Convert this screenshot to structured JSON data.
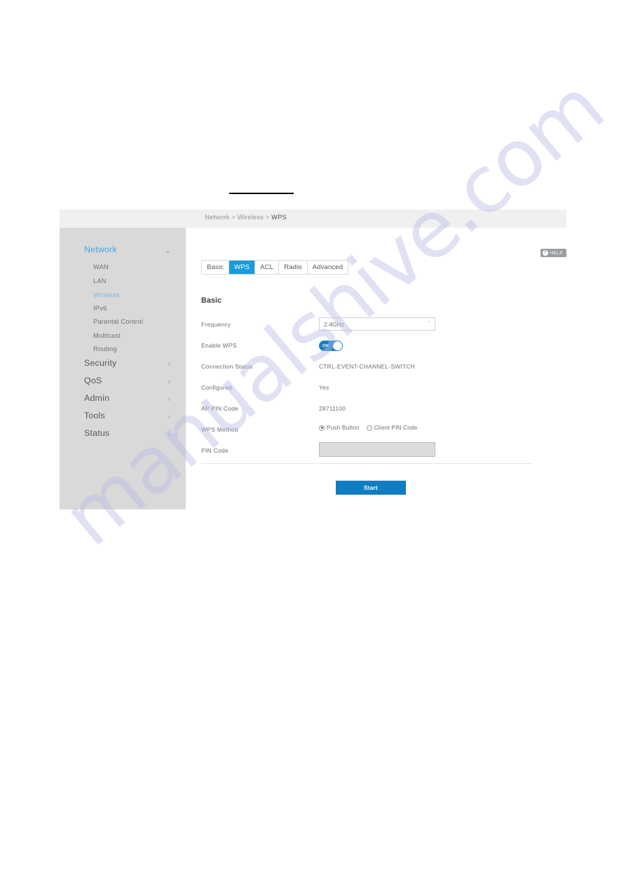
{
  "page": {
    "watermark": "manualshive.com"
  },
  "breadcrumb": {
    "items": [
      "Network",
      "Wireless",
      "WPS"
    ],
    "part1": "Network",
    "sep1": " > ",
    "part2": "Wireless",
    "sep2": " > ",
    "part3": "WPS"
  },
  "help": {
    "label": "HELP",
    "icon": "question-mark-circle-icon",
    "glyph": "?"
  },
  "sidebar": {
    "groups": [
      {
        "label": "Network",
        "active": true,
        "chevron": "chevron-down-icon",
        "chevron_glyph": "⌄",
        "children": [
          {
            "label": "WAN",
            "selected": false
          },
          {
            "label": "LAN",
            "selected": false
          },
          {
            "label": "Wireless",
            "selected": true
          },
          {
            "label": "IPv6",
            "selected": false
          },
          {
            "label": "Parental Control",
            "selected": false
          },
          {
            "label": "Multicast",
            "selected": false
          },
          {
            "label": "Routing",
            "selected": false
          }
        ]
      },
      {
        "label": "Security",
        "active": false,
        "chevron_glyph": "›",
        "children": []
      },
      {
        "label": "QoS",
        "active": false,
        "chevron_glyph": "›",
        "children": []
      },
      {
        "label": "Admin",
        "active": false,
        "chevron_glyph": "›",
        "children": []
      },
      {
        "label": "Tools",
        "active": false,
        "chevron_glyph": "›",
        "children": []
      },
      {
        "label": "Status",
        "active": false,
        "chevron_glyph": "›",
        "children": []
      }
    ]
  },
  "tabs": [
    {
      "label": "Basic",
      "active": false
    },
    {
      "label": "WPS",
      "active": true
    },
    {
      "label": "ACL",
      "active": false
    },
    {
      "label": "Radio",
      "active": false
    },
    {
      "label": "Advanced",
      "active": false
    }
  ],
  "main": {
    "section_title": "Basic",
    "fields": {
      "frequency": {
        "label": "Frequency",
        "value": "2.4GHz",
        "caret": "⌃",
        "options": [
          "2.4GHz"
        ]
      },
      "enable_wps": {
        "label": "Enable WPS",
        "state": "ON"
      },
      "connection_status": {
        "label": "Connection Status",
        "value": "CTRL-EVENT-CHANNEL-SWITCH"
      },
      "configured": {
        "label": "Configured",
        "value": "Yes"
      },
      "ap_pin_code": {
        "label": "AP PIN Code",
        "value": "28711100"
      },
      "wps_method": {
        "label": "WPS Method",
        "options": [
          {
            "label": "Push Button",
            "checked": true
          },
          {
            "label": "Client PIN Code",
            "checked": false
          }
        ]
      },
      "pin_code": {
        "label": "PIN Code",
        "value": "",
        "disabled": true
      }
    },
    "start_button": "Start"
  },
  "colors": {
    "accent": "#1a9bdc",
    "button": "#0f7dc2",
    "toggle_on": "#1a7fc1",
    "sidebar_bg": "#d9d9d9",
    "breadcrumb_bg": "#f0f0f0",
    "link_blue": "#78b9ea"
  }
}
